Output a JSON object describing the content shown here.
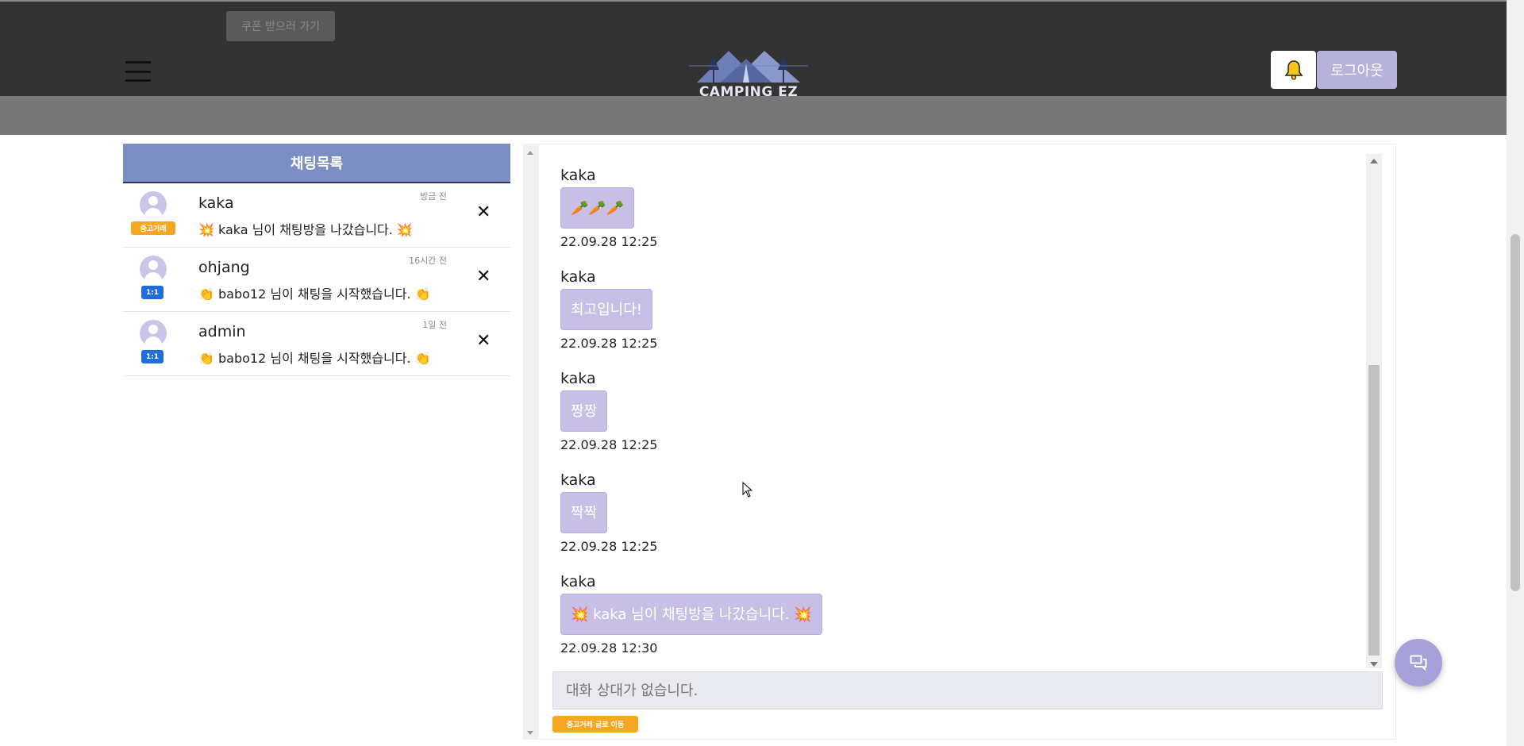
{
  "header": {
    "coupon_label": "쿠폰 받으러 가기",
    "logo_text": "CAMPING EZ",
    "bell_icon": "bell-icon",
    "logout_label": "로그아웃",
    "colors": {
      "bar": "#333333",
      "band": "#777777",
      "logout_bg": "#b6b2dc"
    }
  },
  "chatlist": {
    "title": "채팅목록",
    "items": [
      {
        "name": "kaka",
        "time": "방금 전",
        "tag": "중고거래",
        "preview": "💥 kaka 님이 채팅방을 나갔습니다. 💥"
      },
      {
        "name": "ohjang",
        "time": "16시간 전",
        "tag": "1:1",
        "preview": "👏 babo12 님이 채팅을 시작했습니다. 👏"
      },
      {
        "name": "admin",
        "time": "1일 전",
        "tag": "1:1",
        "preview": "👏 babo12 님이 채팅을 시작했습니다. 👏"
      }
    ],
    "close_glyph": "✕",
    "colors": {
      "header_bg": "#7b8fc5",
      "used_tag": "#f5a623",
      "oneone_tag": "#1e6fd9"
    }
  },
  "messages": [
    {
      "sender": "kaka",
      "text": "🥕🥕🥕",
      "time": "22.09.28 12:25"
    },
    {
      "sender": "kaka",
      "text": "최고입니다!",
      "time": "22.09.28 12:25"
    },
    {
      "sender": "kaka",
      "text": "짱짱",
      "time": "22.09.28 12:25"
    },
    {
      "sender": "kaka",
      "text": "짝짝",
      "time": "22.09.28 12:25"
    },
    {
      "sender": "kaka",
      "text": "💥 kaka 님이 채팅방을 나갔습니다. 💥",
      "time": "22.09.28 12:30"
    }
  ],
  "input": {
    "placeholder": "대화 상대가 없습니다."
  },
  "footer_tag": "중고거래 글로 이동",
  "fab_icon": "chat-bubbles-icon",
  "bubble_color": "#c8bfe7"
}
